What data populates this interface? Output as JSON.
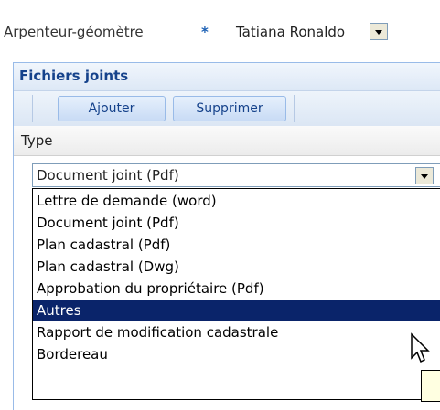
{
  "surveyor": {
    "label": "Arpenteur-géomètre",
    "required_mark": "*",
    "selected": "Tatiana Ronaldo"
  },
  "attachments": {
    "title": "Fichiers joints",
    "toolbar": {
      "add_label": "Ajouter",
      "delete_label": "Supprimer"
    },
    "column_header": "Type",
    "type_combo": {
      "value": "Document joint (Pdf)",
      "options": [
        "Lettre de demande (word)",
        "Document joint (Pdf)",
        "Plan cadastral (Pdf)",
        "Plan cadastral (Dwg)",
        "Approbation du propriétaire (Pdf)",
        "Autres",
        "Rapport de modification cadastrale",
        "Bordereau"
      ],
      "highlighted": "Autres"
    }
  },
  "colors": {
    "highlight": "#0a246a",
    "title": "#15428b",
    "required": "#1a5fb4"
  }
}
